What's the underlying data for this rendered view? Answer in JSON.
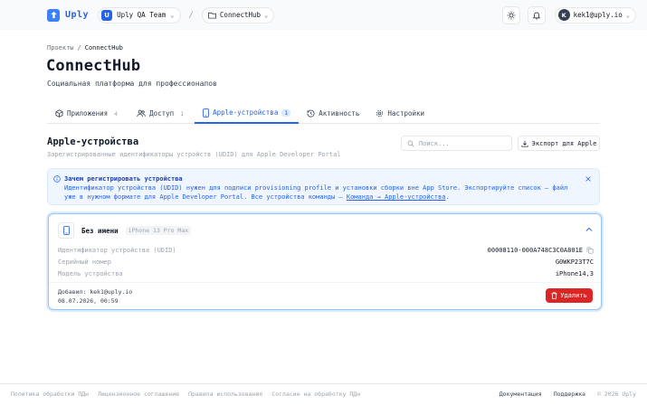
{
  "header": {
    "brand": "Uply",
    "team_initial": "U",
    "team_name": "Uply QA Team",
    "separator": "/",
    "project_name": "ConnectHub",
    "user_initial": "K",
    "user_email": "kek1@uply.io"
  },
  "breadcrumb": {
    "parent": "Проекты",
    "sep": "/",
    "current": "ConnectHub"
  },
  "page": {
    "title": "ConnectHub",
    "subtitle": "Социальная платформа для профессионалов"
  },
  "tabs": [
    {
      "label": "Приложения",
      "count": "4",
      "icon": "box-icon"
    },
    {
      "label": "Доступ",
      "count": "1",
      "icon": "users-icon"
    },
    {
      "label": "Apple-устройства",
      "count": "1",
      "icon": "phone-icon",
      "active": true
    },
    {
      "label": "Активность",
      "count": "",
      "icon": "history-icon"
    },
    {
      "label": "Настройки",
      "count": "",
      "icon": "gear-icon"
    }
  ],
  "section": {
    "title": "Apple-устройства",
    "subtitle": "Зарегистрированные идентификаторы устройств (UDID) для Apple Developer Portal",
    "search_placeholder": "Поиск...",
    "export_label": "Экспорт для Apple"
  },
  "info": {
    "title": "Зачем регистрировать устройства",
    "body": "Идентификатор устройства (UDID) нужен для подписи provisioning profile и установки сборки вне App Store. Экспортируйте список — файл уже в нужном формате для Apple Developer Portal. Все устройства команды — ",
    "link": "Команда → Apple-устройства",
    "body_end": "."
  },
  "device": {
    "name": "Без имени",
    "model_tag": "iPhone 13 Pro Max",
    "rows": [
      {
        "label": "Идентификатор устройства (UDID)",
        "value": "00008110-000A748C3C0A801E"
      },
      {
        "label": "Серийный номер",
        "value": "G0WKP23T7C"
      },
      {
        "label": "Модель устройства",
        "value": "iPhone14,3"
      }
    ],
    "added_by": "Добавил: kek1@uply.io",
    "added_at": "08.07.2026, 00:59",
    "delete_label": "Удалить"
  },
  "footer": {
    "links": [
      "Политика обработки ПДн",
      "Лицензионное соглашение",
      "Правила использования",
      "Согласие на обработку ПДн"
    ],
    "docs": "Документация",
    "support": "Поддержка",
    "copyright": "© 2026 Uply"
  },
  "colors": {
    "accent": "#2563eb",
    "danger": "#dc2626",
    "info_bg": "#eff6ff"
  }
}
